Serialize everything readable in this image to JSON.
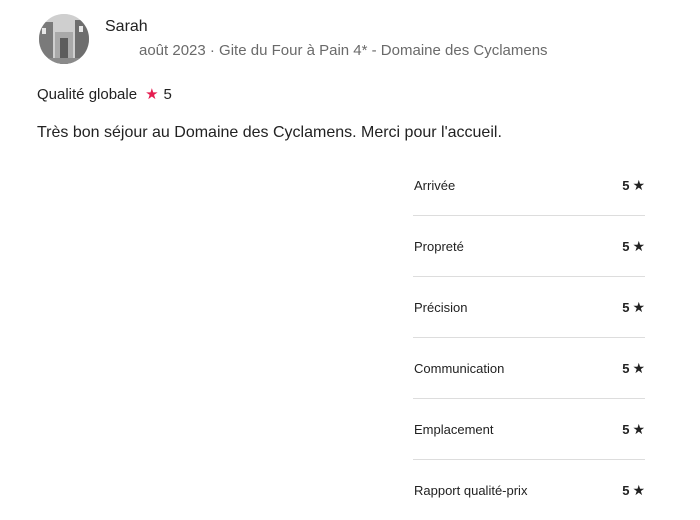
{
  "review": {
    "reviewer_name": "Sarah",
    "stay_meta": "août 2023 · Gite du Four à Pain 4* - Domaine des Cyclamens",
    "overall_label": "Qualité globale",
    "overall_score": "5",
    "text": "Très bon séjour au Domaine des Cyclamens. Merci pour l'accueil."
  },
  "ratings": [
    {
      "label": "Arrivée",
      "score": "5"
    },
    {
      "label": "Propreté",
      "score": "5"
    },
    {
      "label": "Précision",
      "score": "5"
    },
    {
      "label": "Communication",
      "score": "5"
    },
    {
      "label": "Emplacement",
      "score": "5"
    },
    {
      "label": "Rapport qualité-prix",
      "score": "5"
    }
  ],
  "icons": {
    "overall_star": "star-icon",
    "rating_star": "star-icon"
  },
  "colors": {
    "accent_star": "#e51d50",
    "text": "#222222",
    "secondary_text": "#6a6a6a",
    "divider": "#dddddd"
  }
}
